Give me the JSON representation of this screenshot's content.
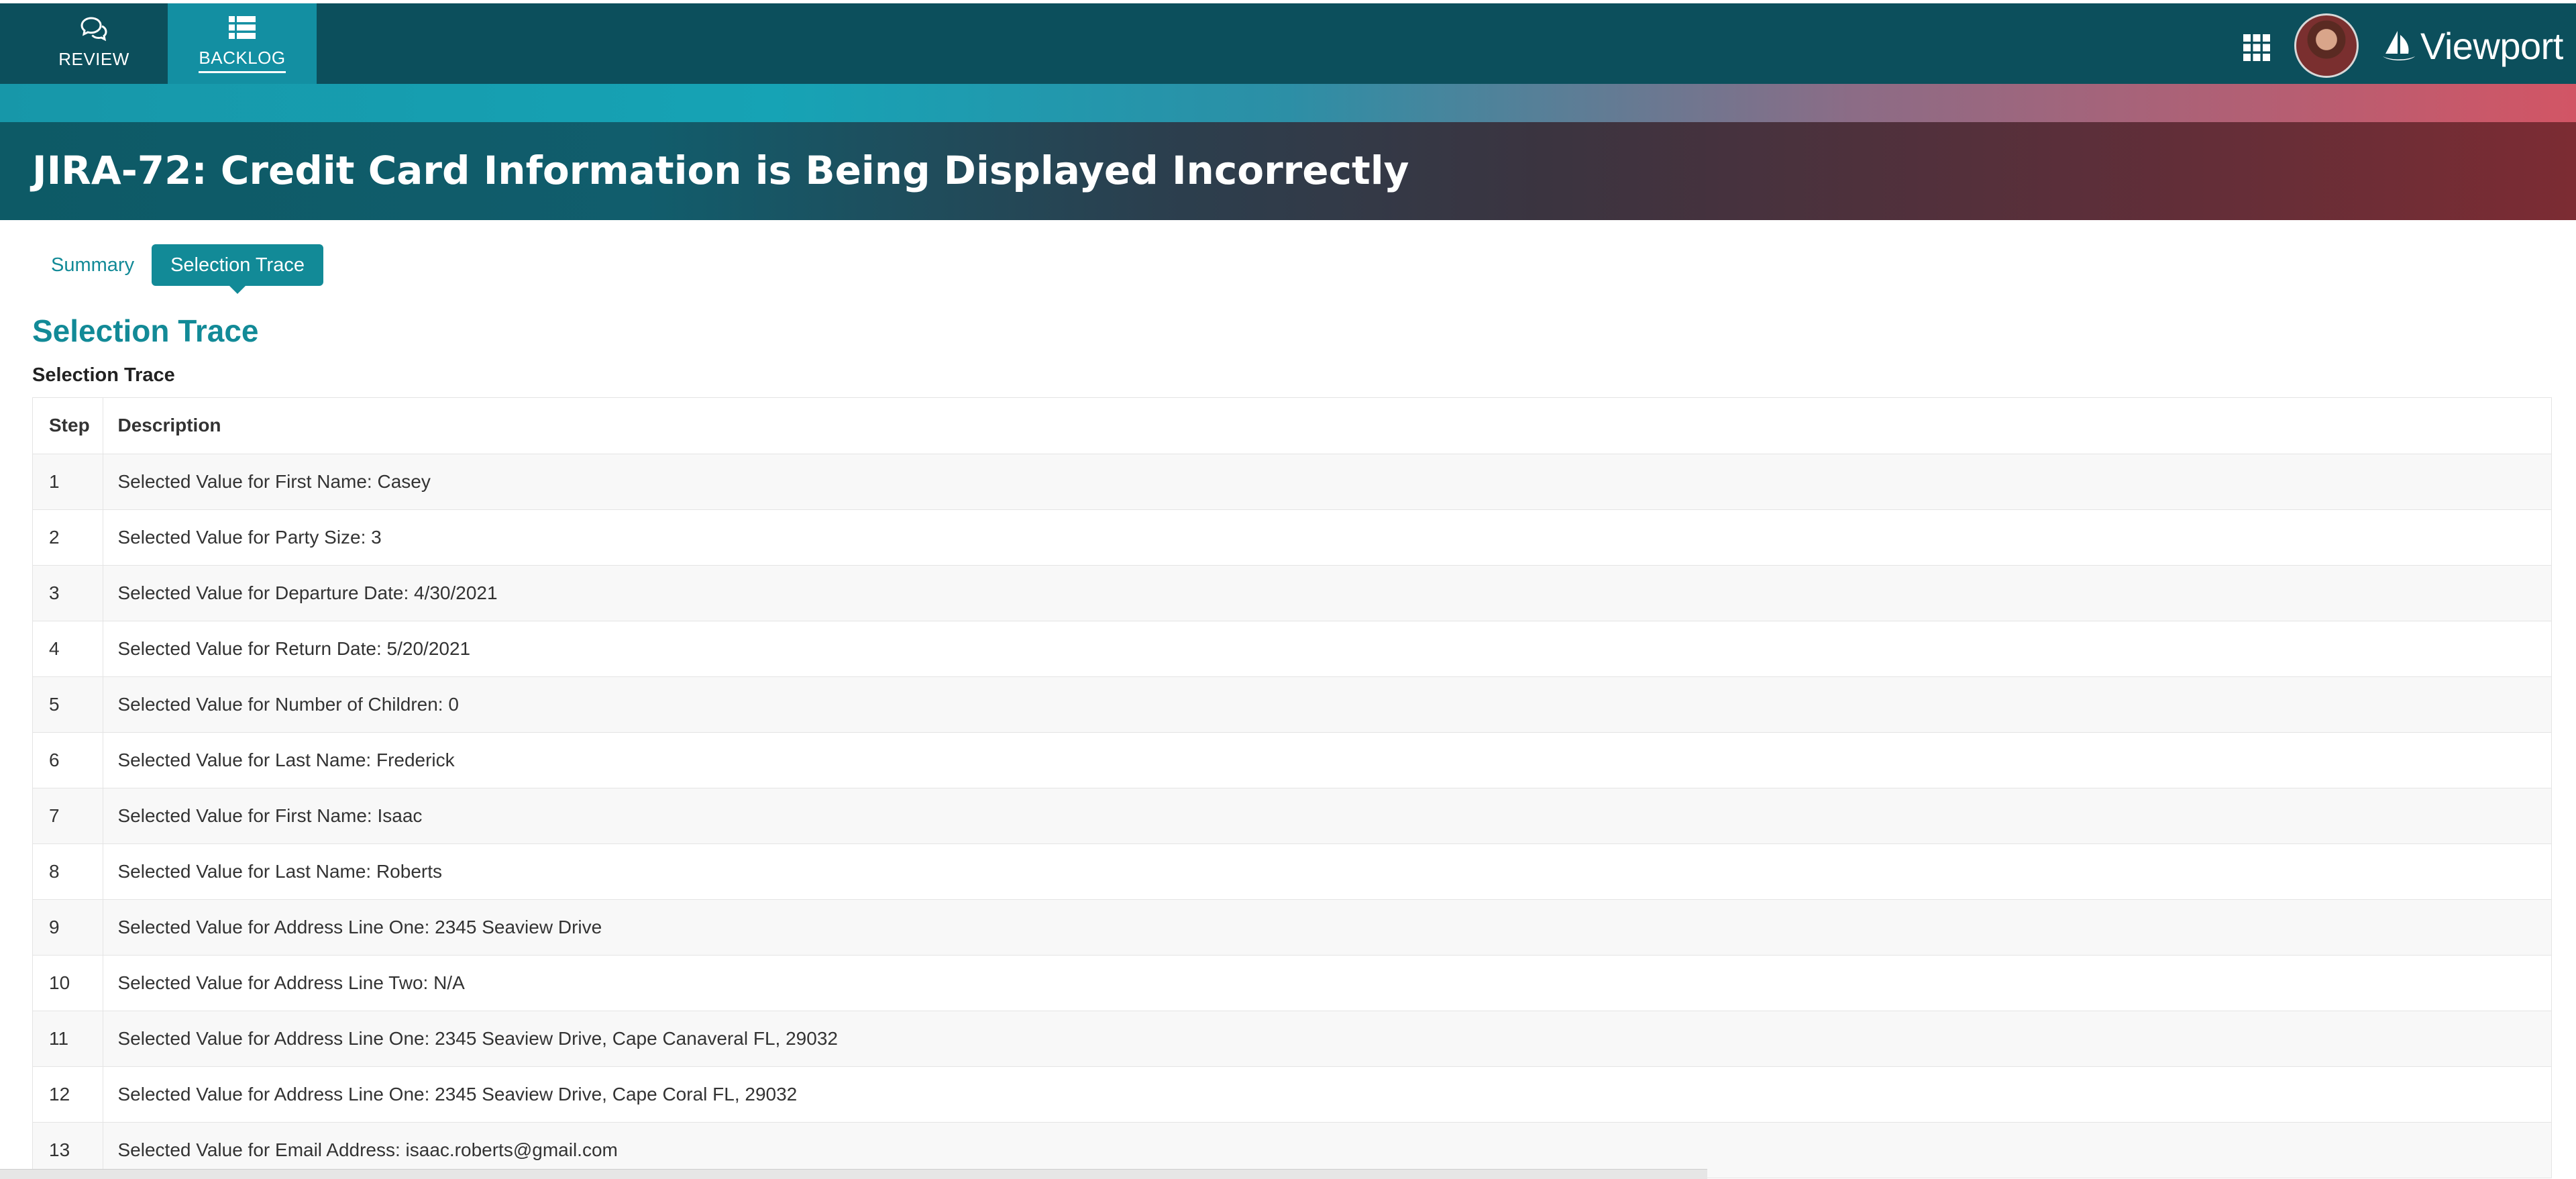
{
  "nav": {
    "items": [
      {
        "label": "REVIEW",
        "icon": "chat-bubbles-icon"
      },
      {
        "label": "BACKLOG",
        "icon": "list-icon",
        "active": true
      }
    ]
  },
  "header": {
    "brand": "Viewport",
    "icons": [
      "apps-grid-icon",
      "avatar",
      "sailboat-logo-icon"
    ]
  },
  "page": {
    "title": "JIRA-72: Credit Card Information is Being Displayed Incorrectly"
  },
  "tabs": [
    {
      "label": "Summary",
      "active": false
    },
    {
      "label": "Selection Trace",
      "active": true
    }
  ],
  "section": {
    "title": "Selection Trace",
    "subtitle": "Selection Trace"
  },
  "table": {
    "headers": [
      "Step",
      "Description"
    ],
    "rows": [
      {
        "step": "1",
        "description": "Selected Value for First Name: Casey"
      },
      {
        "step": "2",
        "description": "Selected Value for Party Size: 3"
      },
      {
        "step": "3",
        "description": "Selected Value for Departure Date: 4/30/2021"
      },
      {
        "step": "4",
        "description": "Selected Value for Return Date: 5/20/2021"
      },
      {
        "step": "5",
        "description": "Selected Value for Number of Children: 0"
      },
      {
        "step": "6",
        "description": "Selected Value for Last Name: Frederick"
      },
      {
        "step": "7",
        "description": "Selected Value for First Name: Isaac"
      },
      {
        "step": "8",
        "description": "Selected Value for Last Name: Roberts"
      },
      {
        "step": "9",
        "description": "Selected Value for Address Line One: 2345 Seaview Drive"
      },
      {
        "step": "10",
        "description": "Selected Value for Address Line Two: N/A"
      },
      {
        "step": "11",
        "description": "Selected Value for Address Line One: 2345 Seaview Drive, Cape Canaveral FL, 29032"
      },
      {
        "step": "12",
        "description": "Selected Value for Address Line One: 2345 Seaview Drive, Cape Coral FL, 29032"
      },
      {
        "step": "13",
        "description": "Selected Value for Email Address: isaac.roberts@gmail.com"
      }
    ]
  },
  "colors": {
    "nav_bg": "#0c4f5c",
    "nav_active": "#138fa2",
    "accent": "#128a97",
    "banner_start": "#0d5a66",
    "banner_end": "#7c2c33"
  }
}
